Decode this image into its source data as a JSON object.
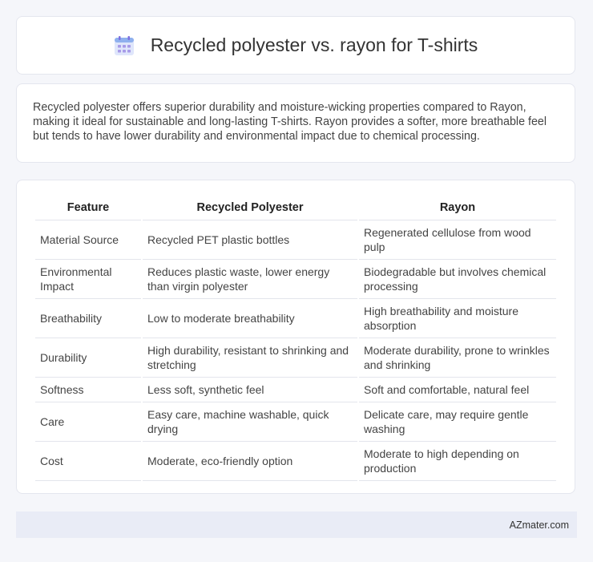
{
  "header": {
    "title": "Recycled polyester vs. rayon for T-shirts",
    "icon": "calendar-icon"
  },
  "summary": "Recycled polyester offers superior durability and moisture-wicking properties compared to Rayon, making it ideal for sustainable and long-lasting T-shirts. Rayon provides a softer, more breathable feel but tends to have lower durability and environmental impact due to chemical processing.",
  "table": {
    "headers": [
      "Feature",
      "Recycled Polyester",
      "Rayon"
    ],
    "rows": [
      [
        "Material Source",
        "Recycled PET plastic bottles",
        "Regenerated cellulose from wood pulp"
      ],
      [
        "Environmental Impact",
        "Reduces plastic waste, lower energy than virgin polyester",
        "Biodegradable but involves chemical processing"
      ],
      [
        "Breathability",
        "Low to moderate breathability",
        "High breathability and moisture absorption"
      ],
      [
        "Durability",
        "High durability, resistant to shrinking and stretching",
        "Moderate durability, prone to wrinkles and shrinking"
      ],
      [
        "Softness",
        "Less soft, synthetic feel",
        "Soft and comfortable, natural feel"
      ],
      [
        "Care",
        "Easy care, machine washable, quick drying",
        "Delicate care, may require gentle washing"
      ],
      [
        "Cost",
        "Moderate, eco-friendly option",
        "Moderate to high depending on production"
      ]
    ]
  },
  "footer": {
    "brand": "AZmater.com"
  },
  "colors": {
    "icon_accent": "#7c6fe0",
    "icon_light": "#b9c6f3",
    "footer_bg": "#e9ecf6"
  }
}
